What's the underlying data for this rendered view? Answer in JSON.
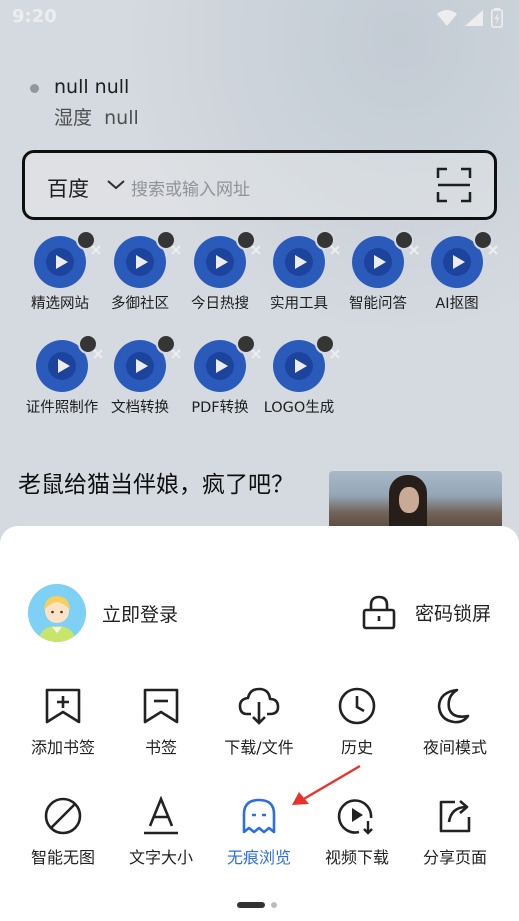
{
  "status_bar": {
    "time": "9:20",
    "icons": [
      "wifi-icon",
      "signal-icon",
      "battery-charging-icon"
    ]
  },
  "weather": {
    "line1": "null  null",
    "line2_label": "湿度",
    "line2_value": "null"
  },
  "search": {
    "engine": "百度",
    "placeholder": "搜索或输入网址"
  },
  "shortcuts": [
    {
      "label": "精选网站"
    },
    {
      "label": "多御社区"
    },
    {
      "label": "今日热搜"
    },
    {
      "label": "实用工具"
    },
    {
      "label": "智能问答"
    },
    {
      "label": "AI抠图"
    },
    {
      "label": "证件照制作"
    },
    {
      "label": "文档转换"
    },
    {
      "label": "PDF转换"
    },
    {
      "label": "LOGO生成"
    }
  ],
  "news": {
    "title": "老鼠给猫当伴娘，疯了吧？"
  },
  "sheet": {
    "login_label": "立即登录",
    "lock_label": "密码锁屏",
    "row1": [
      {
        "label": "添加书签",
        "icon": "add-bookmark-icon"
      },
      {
        "label": "书签",
        "icon": "bookmark-icon"
      },
      {
        "label": "下载/文件",
        "icon": "cloud-download-icon"
      },
      {
        "label": "历史",
        "icon": "clock-icon"
      },
      {
        "label": "夜间模式",
        "icon": "moon-icon"
      }
    ],
    "row2": [
      {
        "label": "智能无图",
        "icon": "no-image-icon"
      },
      {
        "label": "文字大小",
        "icon": "text-size-icon"
      },
      {
        "label": "无痕浏览",
        "icon": "ghost-icon",
        "active": true
      },
      {
        "label": "视频下载",
        "icon": "video-download-icon"
      },
      {
        "label": "分享页面",
        "icon": "share-icon"
      }
    ]
  },
  "colors": {
    "accent": "#2d6fe0",
    "annotation_arrow": "#e8332a",
    "shortcut_icon_bg": "#2f62c9"
  }
}
